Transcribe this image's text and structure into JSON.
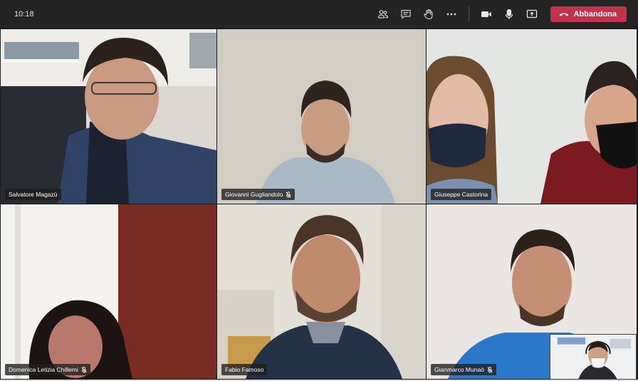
{
  "topbar": {
    "time": "10:18",
    "icons": [
      "participants-icon",
      "chat-icon",
      "raise-hand-icon",
      "more-icon",
      "camera-icon",
      "mic-icon",
      "share-screen-icon"
    ],
    "leave_label": "Abbandona",
    "leave_color": "#c4314b"
  },
  "participants": [
    {
      "name": "Salvatore Magazù",
      "muted": false
    },
    {
      "name": "Giovanni Gugliandolo",
      "muted": true
    },
    {
      "name": "Giuseppe Castorina",
      "muted": false
    },
    {
      "name": "Domenica Letizia Chillemi",
      "muted": true
    },
    {
      "name": "Fabio Famoso",
      "muted": false
    },
    {
      "name": "Gianmarco Munaò",
      "muted": true
    }
  ]
}
